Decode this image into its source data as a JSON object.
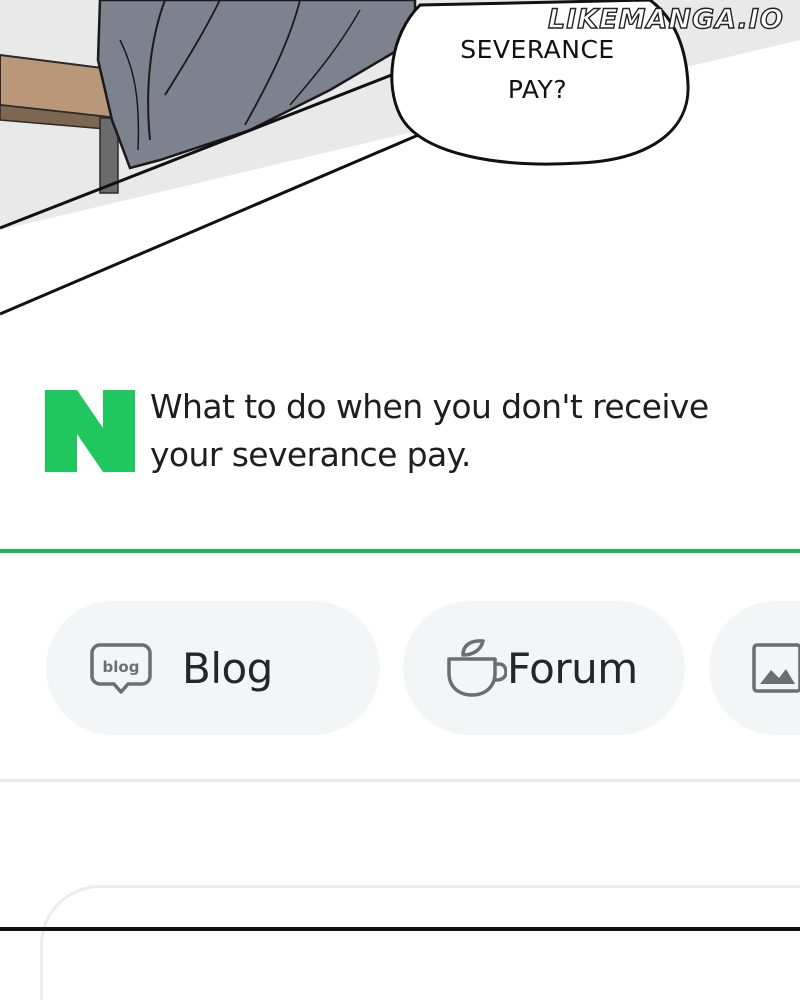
{
  "comic": {
    "speech_line_1": "SEVERANCE",
    "speech_line_2": "PAY?",
    "watermark": "LIKEMANGA.IO"
  },
  "result": {
    "logo_letter": "N",
    "logo_color": "#1fc75e",
    "title": "What to do when you don't receive your severance pay."
  },
  "categories": [
    {
      "label": "Blog",
      "icon": "blog-icon",
      "icon_text": "blog"
    },
    {
      "label": "Forum",
      "icon": "cafe-cup-icon"
    },
    {
      "label": "",
      "icon": "image-icon"
    }
  ],
  "colors": {
    "accent_green": "#1fb35a",
    "chip_background": "#f4f5f7",
    "divider": "#ececee"
  }
}
